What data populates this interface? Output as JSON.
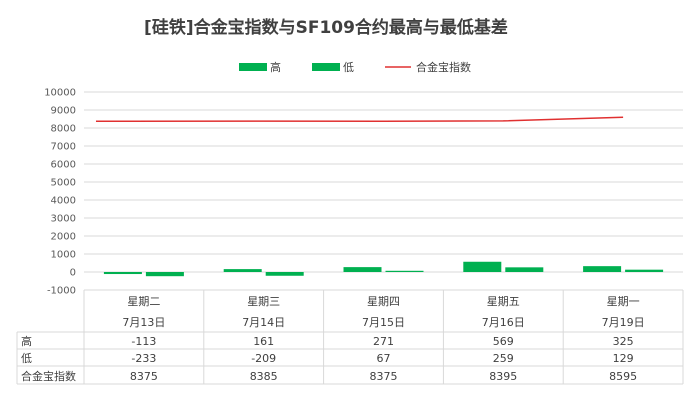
{
  "chart_data": {
    "type": "bar",
    "title": "[硅铁]合金宝指数与SF109合约最高与最低基差",
    "categories": [
      {
        "day": "星期二",
        "date": "7月13日"
      },
      {
        "day": "星期三",
        "date": "7月14日"
      },
      {
        "day": "星期四",
        "date": "7月15日"
      },
      {
        "day": "星期五",
        "date": "7月16日"
      },
      {
        "day": "星期一",
        "date": "7月19日"
      }
    ],
    "series": [
      {
        "name": "高",
        "type": "bar",
        "color": "#00b050",
        "values": [
          -113,
          161,
          271,
          569,
          325
        ]
      },
      {
        "name": "低",
        "type": "bar",
        "color": "#00b050",
        "values": [
          -233,
          -209,
          67,
          259,
          129
        ]
      },
      {
        "name": "合金宝指数",
        "type": "line",
        "color": "#e03030",
        "values": [
          8375,
          8385,
          8375,
          8395,
          8595
        ]
      }
    ],
    "ylim": [
      -1000,
      10000
    ],
    "yticks": [
      10000,
      9000,
      8000,
      7000,
      6000,
      5000,
      4000,
      3000,
      2000,
      1000,
      0,
      -1000
    ],
    "table_values": [
      [
        "-113",
        "161",
        "271",
        "569",
        "325"
      ],
      [
        "-233",
        "-209",
        "67",
        "259",
        "129"
      ],
      [
        "8375",
        "8385",
        "8375",
        "8395",
        "8595"
      ]
    ],
    "grid": true,
    "legend_position": "top"
  }
}
